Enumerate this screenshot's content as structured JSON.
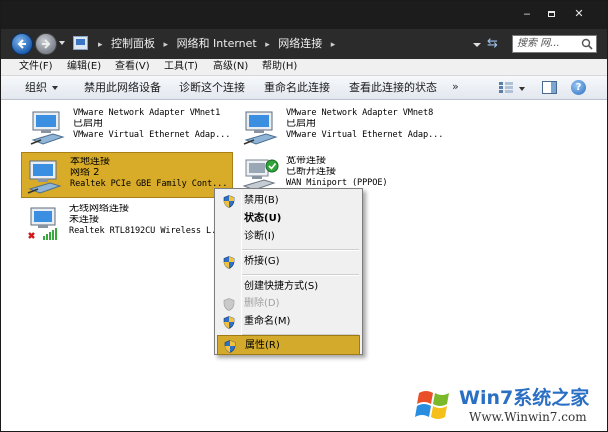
{
  "window": {
    "controls": {
      "minimize": "‒",
      "close": "✕"
    }
  },
  "address": {
    "crumbs": [
      "控制面板",
      "网络和 Internet",
      "网络连接"
    ],
    "search_placeholder": "搜索 网..."
  },
  "menubar": {
    "items": [
      {
        "label": "文件(F)"
      },
      {
        "label": "编辑(E)"
      },
      {
        "label": "查看(V)"
      },
      {
        "label": "工具(T)"
      },
      {
        "label": "高级(N)"
      },
      {
        "label": "帮助(H)"
      }
    ]
  },
  "toolbar": {
    "organize": "组织",
    "disable": "禁用此网络设备",
    "diagnose": "诊断这个连接",
    "rename": "重命名此连接",
    "status": "查看此连接的状态",
    "more": "»",
    "help": "?"
  },
  "connections": [
    {
      "name": "VMware Network Adapter VMnet1",
      "status": "已启用",
      "device": "VMware Virtual Ethernet Adap..."
    },
    {
      "name": "VMware Network Adapter VMnet8",
      "status": "已启用",
      "device": "VMware Virtual Ethernet Adap..."
    },
    {
      "name": "本地连接",
      "status": "网络  2",
      "device": "Realtek PCIe GBE Family Cont..."
    },
    {
      "name": "宽带连接",
      "status": "已断开连接",
      "device": "WAN Miniport (PPPOE)"
    },
    {
      "name": "无线网络连接",
      "status": "未连接",
      "device": "Realtek RTL8192CU Wireless L..."
    }
  ],
  "context_menu": {
    "items": [
      {
        "label": "禁用(B)"
      },
      {
        "label": "状态(U)"
      },
      {
        "label": "诊断(I)"
      },
      {
        "label": "桥接(G)"
      },
      {
        "label": "创建快捷方式(S)"
      },
      {
        "label": "删除(D)"
      },
      {
        "label": "重命名(M)"
      },
      {
        "label": "属性(R)"
      }
    ]
  },
  "watermark": {
    "brand": "Win7系统之家",
    "url": "Www.Winwin7.com"
  },
  "colors": {
    "selection": "#d8ac28",
    "titlebar": "#1c1c1c",
    "menu_highlight": "#d3aa2c"
  }
}
